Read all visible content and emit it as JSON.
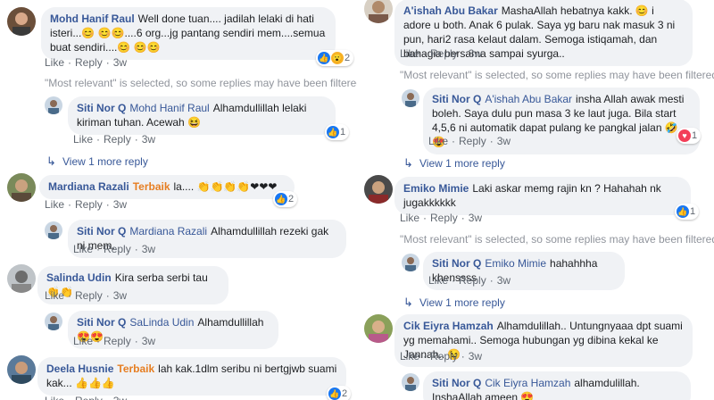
{
  "actions": {
    "like": "Like",
    "reply": "Reply",
    "dot": "·"
  },
  "filter_notice": "\"Most relevant\" is selected, so some replies may have been filtered out.",
  "left": {
    "c1": {
      "name": "Mohd Hanif Raul",
      "text": "Well done tuan.... jadilah lelaki di hati isteri...😊 😊😊....6 org...jg pantang sendiri mem....semua buat sendiri....😊 😊😊",
      "time": "3w",
      "reactions": "2"
    },
    "r1": {
      "name": "Siti Nor Q",
      "tag": "Mohd Hanif Raul",
      "text": "Alhamdullillah lelaki kiriman tuhan. Acewah 😆",
      "time": "3w",
      "reactions": "1"
    },
    "more1": "View 1 more reply",
    "c2": {
      "name": "Mardiana Razali",
      "badge": "Terbaik",
      "text": "la.... 👏👏👏👏❤❤❤",
      "time": "3w",
      "reactions": "2"
    },
    "r2": {
      "name": "Siti Nor Q",
      "tag": "Mardiana Razali",
      "text": "Alhamdullillah rezeki gak ni mem.",
      "time": "3w"
    },
    "c3": {
      "name": "Salinda Udin",
      "text": "Kira serba serbi tau 👏👏",
      "time": "3w"
    },
    "r3": {
      "name": "Siti Nor Q",
      "tag": "SaLinda Udin",
      "text": "Alhamdullillah 😍😍",
      "time": "3w"
    },
    "c4": {
      "name": "Deela Husnie",
      "badge": "Terbaik",
      "text": "lah kak.1dlm seribu ni bertgjwb suami kak... 👍👍👍",
      "time": "3w",
      "reactions": "2"
    }
  },
  "right": {
    "c1": {
      "name": "A'ishah Abu Bakar",
      "text": "MashaAllah hebatnya kakk. 😊 i adore u both. Anak 6 pulak. Saya yg baru nak masuk 3 ni pun, hari2 rasa kelaut dalam. Semoga istiqamah, dan bahagia bersama sampai syurga..",
      "time": "3w"
    },
    "r1": {
      "name": "Siti Nor Q",
      "tag": "A'ishah Abu Bakar",
      "text": "insha Allah awak mesti boleh. Saya dulu pun masa 3 ke laut juga. Bila start 4,5,6 ni automatik dapat pulang ke pangkal jalan 🤣😍",
      "time": "3w",
      "reactions": "1"
    },
    "more1": "View 1 more reply",
    "c2": {
      "name": "Emiko Mimie",
      "text": "Laki askar memg rajin kn ? Hahahah nk jugakkkkkk",
      "time": "3w",
      "reactions": "1"
    },
    "r2": {
      "name": "Siti Nor Q",
      "tag": "Emiko Mimie",
      "text": "hahahhha khenssss",
      "time": "3w"
    },
    "more2": "View 1 more reply",
    "c3": {
      "name": "Cik Eiyra Hamzah",
      "text": "Alhamdulillah.. Untungnyaaa dpt suami yg memahami.. Semoga hubungan yg dibina kekal ke Jannah.. 😉",
      "time": "3w"
    },
    "r3": {
      "name": "Siti Nor Q",
      "tag": "Cik Eiyra Hamzah",
      "text": "alhamdulillah. InshaAllah ameen 😍",
      "time": "3w"
    }
  },
  "colors": {
    "link": "#385898",
    "badge": "#e67e22",
    "bubble": "#f0f2f5",
    "meta": "#606770",
    "like": "#1877f2",
    "love": "#f33e58"
  }
}
